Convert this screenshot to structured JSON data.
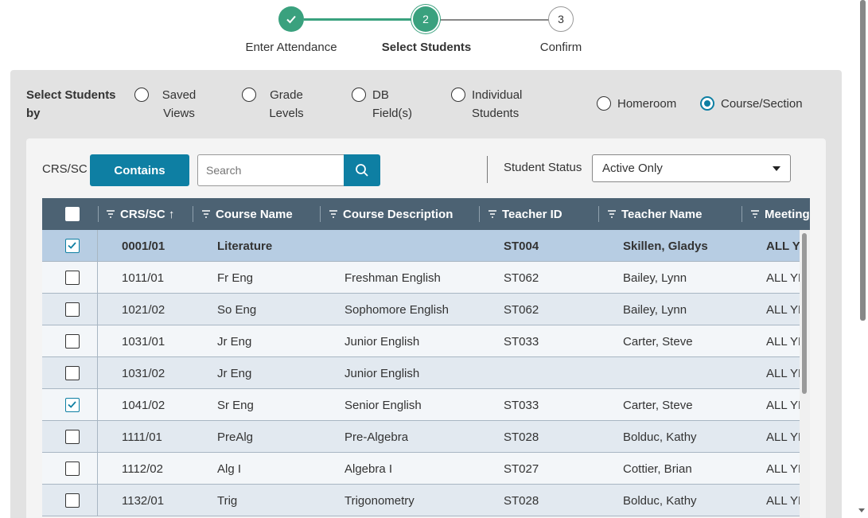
{
  "stepper": {
    "steps": [
      {
        "number": "1",
        "label": "Enter Attendance",
        "state": "done"
      },
      {
        "number": "2",
        "label": "Select Students",
        "state": "active"
      },
      {
        "number": "3",
        "label": "Confirm",
        "state": "todo"
      }
    ],
    "colors": {
      "done": "#3aa17e",
      "todo_line": "#888888"
    }
  },
  "select_by": {
    "label": "Select Students by",
    "options": [
      {
        "label": "Saved Views",
        "checked": false
      },
      {
        "label": "Grade Levels",
        "checked": false
      },
      {
        "label": "DB Field(s)",
        "checked": false
      },
      {
        "label": "Individual Students",
        "checked": false
      },
      {
        "label": "Homeroom",
        "checked": false
      },
      {
        "label": "Course/Section",
        "checked": true
      }
    ]
  },
  "filter": {
    "field_label": "CRS/SC",
    "operator_label": "Contains",
    "search_placeholder": "Search",
    "search_value": "",
    "status_label": "Student Status",
    "status_value": "Active Only",
    "accent_color": "#0e7fa3"
  },
  "table": {
    "columns": [
      {
        "label": "CRS/SC ↑",
        "sorted": "asc"
      },
      {
        "label": "Course Name"
      },
      {
        "label": "Course Description"
      },
      {
        "label": "Teacher ID"
      },
      {
        "label": "Teacher Name"
      },
      {
        "label": "Meeting"
      }
    ],
    "header_color": "#4c6273",
    "rows": [
      {
        "checked": true,
        "selected": true,
        "crs": "0001/01",
        "name": "Literature",
        "desc": "",
        "tid": "ST004",
        "tname": "Skillen, Gladys",
        "meeting": "ALL YE"
      },
      {
        "checked": false,
        "selected": false,
        "crs": "1011/01",
        "name": "Fr Eng",
        "desc": "Freshman English",
        "tid": "ST062",
        "tname": "Bailey, Lynn",
        "meeting": "ALL YE"
      },
      {
        "checked": false,
        "selected": false,
        "crs": "1021/02",
        "name": "So Eng",
        "desc": "Sophomore English",
        "tid": "ST062",
        "tname": "Bailey, Lynn",
        "meeting": "ALL YE"
      },
      {
        "checked": false,
        "selected": false,
        "crs": "1031/01",
        "name": "Jr Eng",
        "desc": "Junior English",
        "tid": "ST033",
        "tname": "Carter, Steve",
        "meeting": "ALL YE"
      },
      {
        "checked": false,
        "selected": false,
        "crs": "1031/02",
        "name": "Jr Eng",
        "desc": "Junior English",
        "tid": "",
        "tname": "",
        "meeting": "ALL YE"
      },
      {
        "checked": true,
        "selected": false,
        "crs": "1041/02",
        "name": "Sr Eng",
        "desc": "Senior English",
        "tid": "ST033",
        "tname": "Carter, Steve",
        "meeting": "ALL YE"
      },
      {
        "checked": false,
        "selected": false,
        "crs": "1111/01",
        "name": "PreAlg",
        "desc": "Pre-Algebra",
        "tid": "ST028",
        "tname": "Bolduc, Kathy",
        "meeting": "ALL YE"
      },
      {
        "checked": false,
        "selected": false,
        "crs": "1112/02",
        "name": "Alg I",
        "desc": "Algebra I",
        "tid": "ST027",
        "tname": "Cottier, Brian",
        "meeting": "ALL YE"
      },
      {
        "checked": false,
        "selected": false,
        "crs": "1132/01",
        "name": "Trig",
        "desc": "Trigonometry",
        "tid": "ST028",
        "tname": "Bolduc, Kathy",
        "meeting": "ALL YE"
      }
    ]
  }
}
